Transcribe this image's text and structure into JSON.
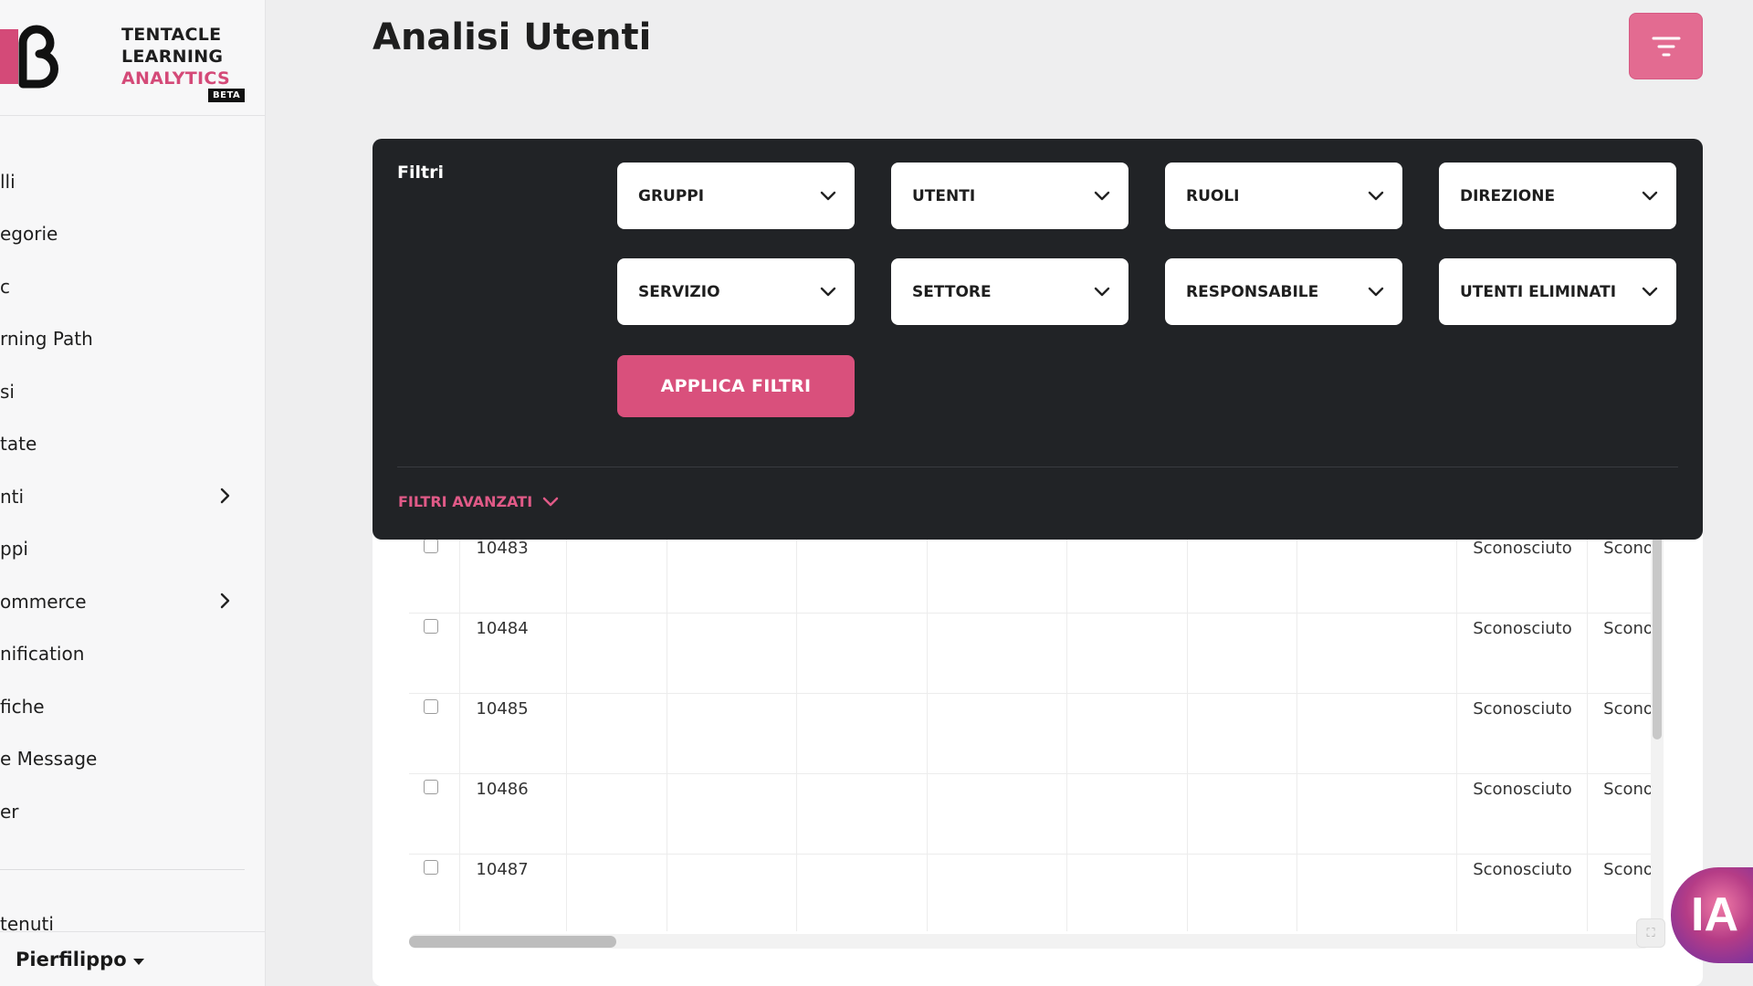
{
  "brand": {
    "line1": "TENTACLE",
    "line2": "LEARNING",
    "line3": "ANALYTICS",
    "badge": "BETA"
  },
  "sidebar": {
    "items": [
      {
        "label": "lli",
        "offset": 0,
        "chevron": false
      },
      {
        "label": "egorie",
        "offset": 0,
        "chevron": false
      },
      {
        "label": "c",
        "offset": 0,
        "chevron": false
      },
      {
        "label": "rning Path",
        "offset": 0,
        "chevron": false
      },
      {
        "label": "si",
        "offset": 0,
        "chevron": false
      },
      {
        "label": "tate",
        "offset": 0,
        "chevron": false
      },
      {
        "label": "nti",
        "offset": 0,
        "chevron": true
      },
      {
        "label": "ppi",
        "offset": 0,
        "chevron": false
      },
      {
        "label": "ommerce",
        "offset": 0,
        "chevron": true
      },
      {
        "label": "nification",
        "offset": 0,
        "chevron": false
      },
      {
        "label": "fiche",
        "offset": 0,
        "chevron": false
      },
      {
        "label": "e Message",
        "offset": 0,
        "chevron": false
      },
      {
        "label": "er",
        "offset": 0,
        "chevron": false
      }
    ],
    "extra_item": "tenuti",
    "user_name": "Pierfilippo"
  },
  "page": {
    "title": "Analisi Utenti"
  },
  "filters": {
    "title": "Filtri",
    "dropdowns": [
      "GRUPPI",
      "UTENTI",
      "RUOLI",
      "DIREZIONE",
      "SERVIZIO",
      "SETTORE",
      "RESPONSABILE",
      "UTENTI ELIMINATI"
    ],
    "apply_label": "APPLICA FILTRI",
    "advanced_label": "FILTRI AVANZATI"
  },
  "table": {
    "rows": [
      {
        "id": "10483",
        "status1": "Sconosciuto",
        "status2": "Scono"
      },
      {
        "id": "10484",
        "status1": "Sconosciuto",
        "status2": "Scono"
      },
      {
        "id": "10485",
        "status1": "Sconosciuto",
        "status2": "Scono"
      },
      {
        "id": "10486",
        "status1": "Sconosciuto",
        "status2": "Scono"
      },
      {
        "id": "10487",
        "status1": "Sconosciuto",
        "status2": "Scono"
      }
    ]
  },
  "assistant": {
    "label": "IA"
  },
  "colors": {
    "accent": "#d9507c",
    "panel": "#212326",
    "sidebar": "#f7f7f8"
  }
}
